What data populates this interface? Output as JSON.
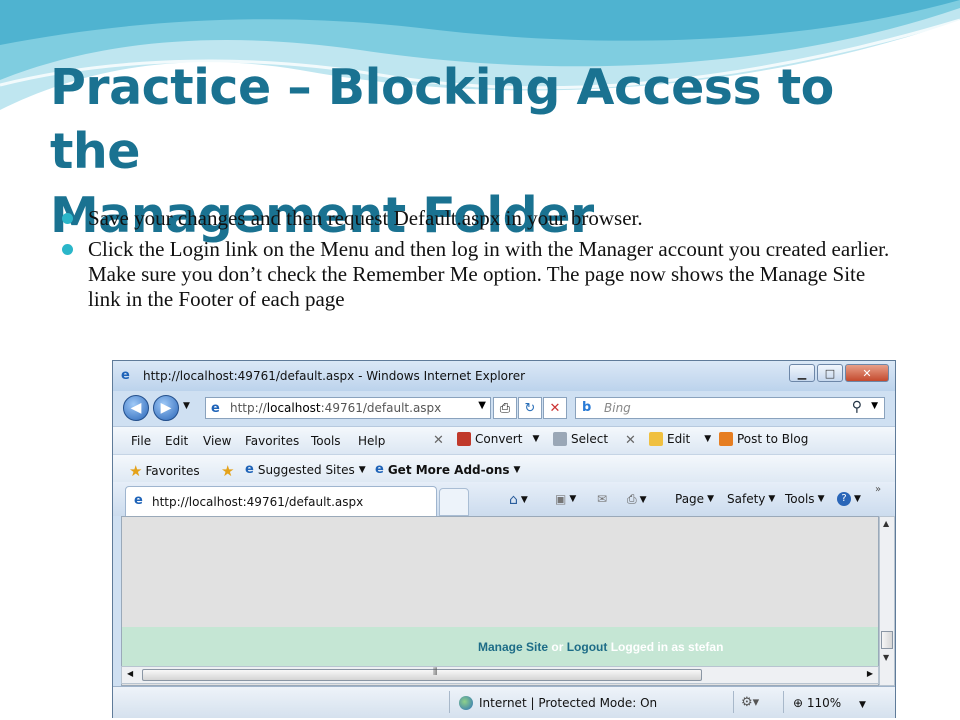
{
  "slide": {
    "title_line1": "Practice – Blocking Access to the",
    "title_line2": "Management Folder",
    "bullets": [
      "Save your changes and then request Default.aspx in your browser.",
      "Click the Login link on the Menu and then log in with the Manager account you created earlier. Make sure you don’t check the Remember Me option. The page now shows the Manage Site link in the Footer of each page"
    ],
    "colors": {
      "title": "#1a7291",
      "bullet": "#2ab6c9"
    }
  },
  "browser": {
    "window_title": "http://localhost:49761/default.aspx - Windows Internet Explorer",
    "address_prefix": "http://",
    "address_host": "localhost",
    "address_rest": ":49761/default.aspx",
    "search_placeholder": "Bing",
    "search_logo": "b",
    "menu": [
      "File",
      "Edit",
      "View",
      "Favorites",
      "Tools",
      "Help"
    ],
    "toolbar": {
      "convert": "Convert",
      "select": "Select",
      "edit": "Edit",
      "post_to_blog": "Post to Blog"
    },
    "favorites_bar": {
      "favorites": "Favorites",
      "suggested": "Suggested Sites",
      "add_ons": "Get More Add-ons"
    },
    "tab_title": "http://localhost:49761/default.aspx",
    "commands": {
      "page": "Page",
      "safety": "Safety",
      "tools": "Tools"
    },
    "footer": {
      "manage_site": "Manage Site",
      "or": "or",
      "logout": "Logout",
      "logged_in": "Logged in as stefan"
    },
    "status": {
      "zone": "Internet | Protected Mode: On",
      "zoom": "110%"
    },
    "icons": [
      "ie-logo-icon",
      "back-icon",
      "forward-icon",
      "refresh-icon",
      "stop-icon",
      "search-icon",
      "home-icon",
      "rss-icon",
      "mail-icon",
      "print-icon",
      "help-icon",
      "globe-icon"
    ]
  }
}
